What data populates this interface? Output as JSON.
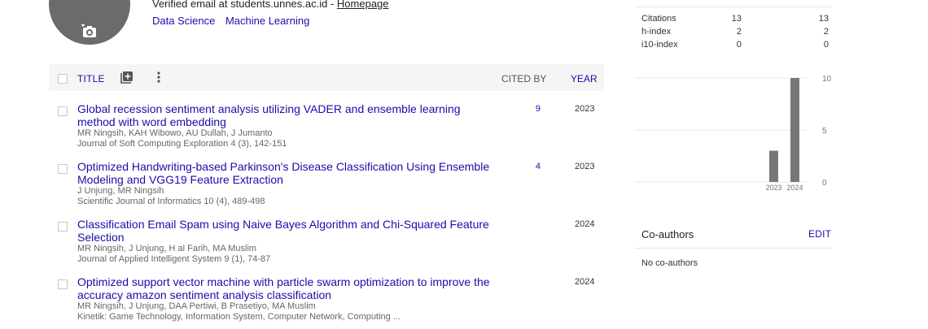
{
  "profile": {
    "email_text": "Verified email at students.unnes.ac.id - ",
    "homepage_label": "Homepage",
    "interests": [
      "Data Science",
      "Machine Learning"
    ]
  },
  "table": {
    "header": {
      "title": "TITLE",
      "cited_by": "CITED BY",
      "year": "YEAR"
    },
    "rows": [
      {
        "title": "Global recession sentiment analysis utilizing VADER and ensemble learning method with word embedding",
        "authors": "MR Ningsih, KAH Wibowo, AU Dullah, J Jumanto",
        "venue": "Journal of Soft Computing Exploration 4 (3), 142-151",
        "cited": "9",
        "year": "2023"
      },
      {
        "title": "Optimized Handwriting-based Parkinson's Disease Classification Using Ensemble Modeling and VGG19 Feature Extraction",
        "authors": "J Unjung, MR Ningsih",
        "venue": "Scientific Journal of Informatics 10 (4), 489-498",
        "cited": "4",
        "year": "2023"
      },
      {
        "title": "Classification Email Spam using Naive Bayes Algorithm and Chi-Squared Feature Selection",
        "authors": "MR Ningsih, J Unjung, H al Farih, MA Muslim",
        "venue": "Journal of Applied Intelligent System 9 (1), 74-87",
        "cited": "",
        "year": "2024"
      },
      {
        "title": "Optimized support vector machine with particle swarm optimization to improve the accuracy amazon sentiment analysis classification",
        "authors": "MR Ningsih, J Unjung, DAA Pertiwi, B Prasetiyo, MA Muslim",
        "venue": "Kinetik: Game Technology, Information System, Computer Network, Computing ...",
        "cited": "",
        "year": "2024"
      }
    ]
  },
  "stats": [
    {
      "label": "Citations",
      "all": "13",
      "since": "13"
    },
    {
      "label": "h-index",
      "all": "2",
      "since": "2"
    },
    {
      "label": "i10-index",
      "all": "0",
      "since": "0"
    }
  ],
  "chart_data": {
    "type": "bar",
    "categories": [
      "2023",
      "2024"
    ],
    "values": [
      3,
      10
    ],
    "ylim": [
      0,
      10
    ],
    "yticks": [
      "0",
      "5",
      "10"
    ],
    "grid": true,
    "bar_color": "#777777"
  },
  "coauthors": {
    "title": "Co-authors",
    "edit_label": "EDIT",
    "empty_text": "No co-authors"
  },
  "icons": {
    "add": "add-to-library-icon",
    "more": "more-vert-icon",
    "camera": "camera-icon"
  },
  "colors": {
    "link": "#1a0dab",
    "header_bg": "#f5f5f5"
  }
}
